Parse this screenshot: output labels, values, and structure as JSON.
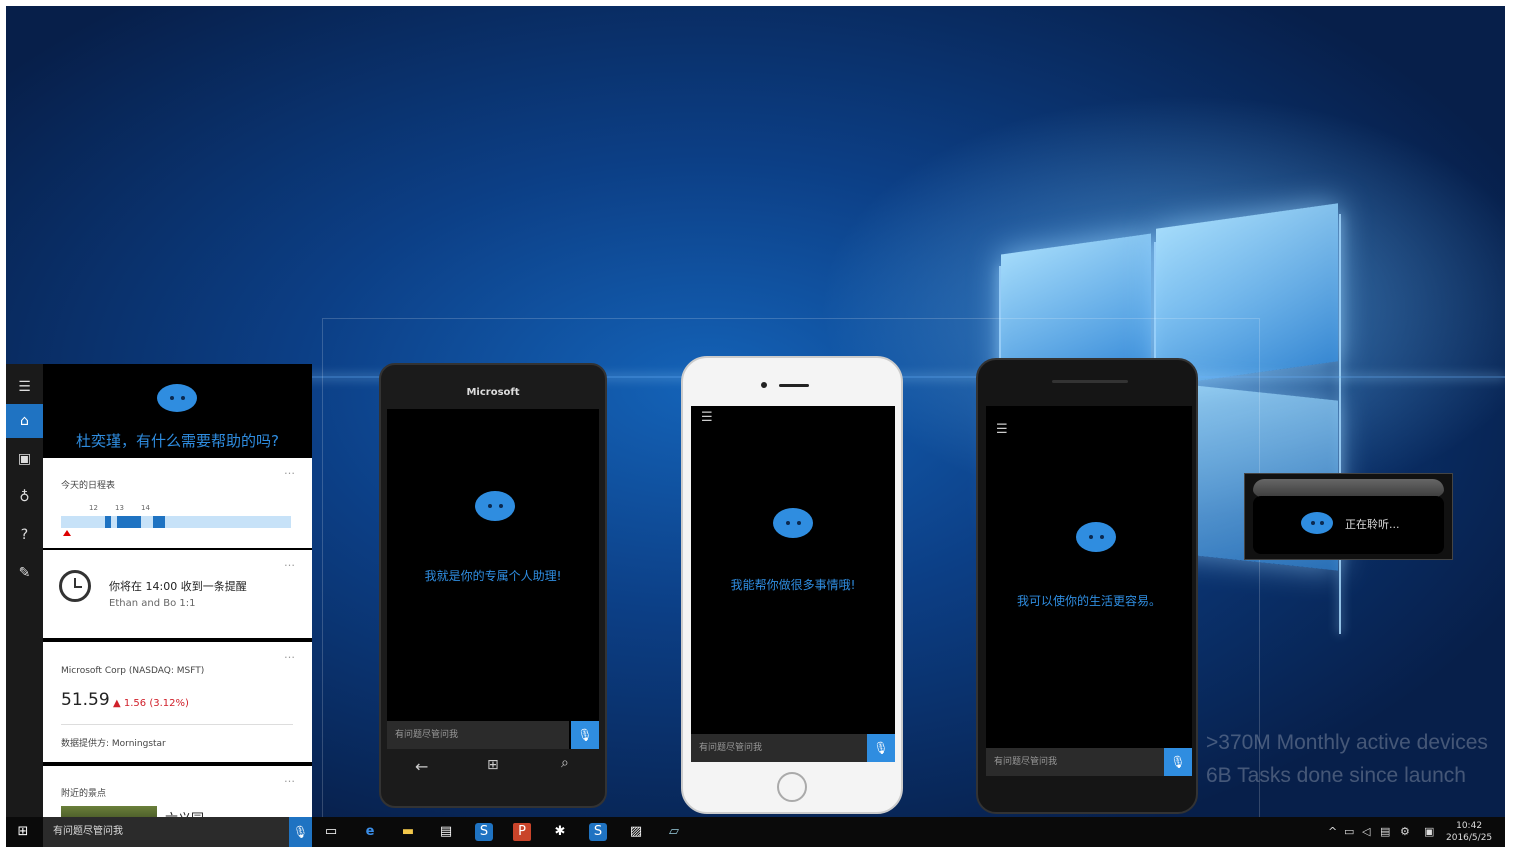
{
  "pc_panel": {
    "greeting": "杜奕瑾，有什么需要帮助的吗?",
    "schedule": {
      "title": "今天的日程表",
      "ticks": [
        "12",
        "13",
        "14"
      ]
    },
    "reminder": {
      "text": "你将在 14:00 收到一条提醒",
      "sub": "Ethan and Bo 1:1"
    },
    "stock": {
      "name": "Microsoft Corp (NASDAQ: MSFT)",
      "price": "51.59",
      "change": "▲ 1.56 (3.12%)",
      "provider": "数据提供方: Morningstar"
    },
    "nearby": {
      "title": "附近的景点",
      "place": "六义园"
    },
    "search_placeholder": "有问题尽管问我",
    "more": "…",
    "accent": "#1f73c2"
  },
  "phones": [
    {
      "brand": "Microsoft",
      "text": "我就是你的专属个人助理!",
      "search": "有问题尽管问我"
    },
    {
      "text": "我能帮你做很多事情哦!",
      "search": "有问题尽管问我"
    },
    {
      "text": "我可以使你的生活更容易。",
      "search": "有问题尽管问我"
    }
  ],
  "listening": {
    "text": "正在聆听..."
  },
  "stats": {
    "line1": ">370M Monthly active devices",
    "line2": "6B Tasks done since launch"
  },
  "taskbar": {
    "time": "10:42",
    "date": "2016/5/25"
  },
  "icons": {
    "menu": "hamburger-icon",
    "home": "home-icon",
    "notebook": "notebook-icon",
    "idea": "lightbulb-icon",
    "help": "help-icon",
    "feedback": "feedback-icon",
    "mic": "microphone-icon"
  }
}
